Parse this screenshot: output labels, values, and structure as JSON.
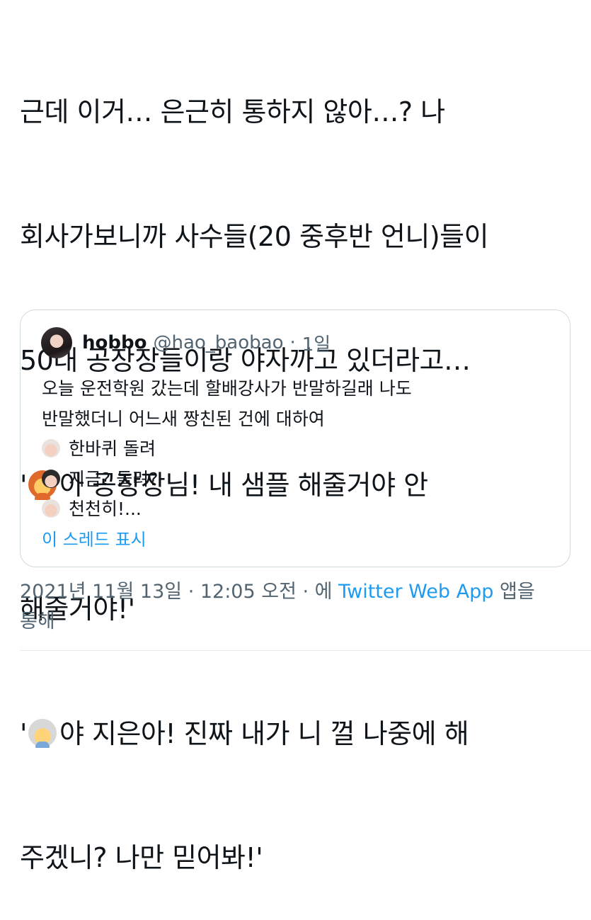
{
  "tweet": {
    "lines": [
      "근데 이거… 은근히 통하지 않아…? 나",
      "회사가보니까 사수들(20 중후반 언니)들이",
      "50대 공장장들이랑 야자까고 있더라고…"
    ],
    "quote1_open": "'",
    "quote1_line1": "아 공장장님! 내 샘플 해줄거야 안",
    "quote1_line2": "해줄거야!'",
    "quote2_open": "'",
    "quote2_line1": "야 지은아! 진짜 내가 니 껄 나중에 해",
    "quote2_line2": "주겠니? 나만 믿어봐!'",
    "emoji_woman": "woman-emoji",
    "emoji_oldman": "older-man-emoji"
  },
  "quoted": {
    "name": "hobbo",
    "handle": "@hao_baobao",
    "separator": "·",
    "time": "1일",
    "line1": "오늘 운전학원 갔는데 할배강사가 반말하길래 나도",
    "line2": "반말했더니 어느새 짱친된 건에 대하여",
    "dialogue": [
      {
        "icon": "older-man-emoji",
        "text": "한바퀴 돌려"
      },
      {
        "icon": "man-emoji",
        "text": "지금? 돌려?"
      },
      {
        "icon": "older-man-emoji",
        "text": "천천히!..."
      }
    ],
    "show_thread": "이 스레드 표시"
  },
  "meta": {
    "date_time": "2021년 11월 13일 · 12:05 오전 · 에 ",
    "app": "Twitter Web App",
    "suffix": " 앱을",
    "line2": "통해"
  },
  "colors": {
    "text": "#0f1419",
    "secondary": "#536471",
    "link": "#1d9bf0",
    "border": "#cfd9de"
  }
}
